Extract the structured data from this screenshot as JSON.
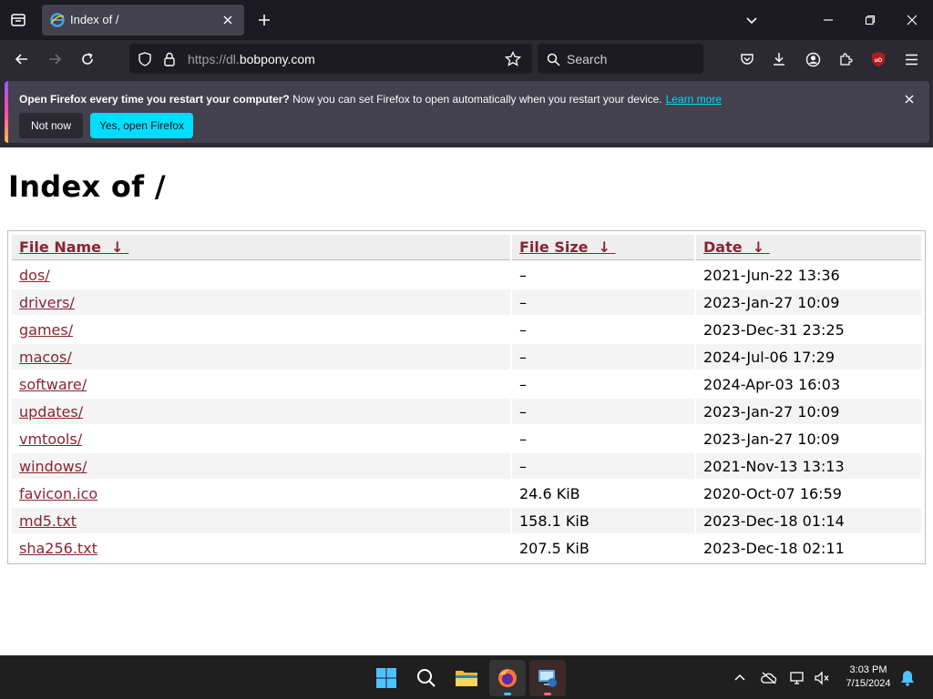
{
  "browser": {
    "tab_title": "Index of /",
    "url_scheme": "https://dl.",
    "url_host": "bobpony.com",
    "search_placeholder": "Search"
  },
  "notification": {
    "bold_text": "Open Firefox every time you restart your computer?",
    "text": " Now you can set Firefox to open automatically when you restart your device.",
    "link_text": "Learn more",
    "not_now_label": "Not now",
    "yes_label": "Yes, open Firefox"
  },
  "page": {
    "title": "Index of /",
    "columns": [
      {
        "label": "File Name",
        "sort_arrow": "↓"
      },
      {
        "label": "File Size",
        "sort_arrow": "↓"
      },
      {
        "label": "Date",
        "sort_arrow": "↓"
      }
    ],
    "rows": [
      {
        "name": "dos/",
        "size": "–",
        "date": "2021-Jun-22 13:36"
      },
      {
        "name": "drivers/",
        "size": "–",
        "date": "2023-Jan-27 10:09"
      },
      {
        "name": "games/",
        "size": "–",
        "date": "2023-Dec-31 23:25"
      },
      {
        "name": "macos/",
        "size": "–",
        "date": "2024-Jul-06 17:29"
      },
      {
        "name": "software/",
        "size": "–",
        "date": "2024-Apr-03 16:03"
      },
      {
        "name": "updates/",
        "size": "–",
        "date": "2023-Jan-27 10:09"
      },
      {
        "name": "vmtools/",
        "size": "–",
        "date": "2023-Jan-27 10:09"
      },
      {
        "name": "windows/",
        "size": "–",
        "date": "2021-Nov-13 13:13"
      },
      {
        "name": "favicon.ico",
        "size": "24.6 KiB",
        "date": "2020-Oct-07 16:59"
      },
      {
        "name": "md5.txt",
        "size": "158.1 KiB",
        "date": "2023-Dec-18 01:14"
      },
      {
        "name": "sha256.txt",
        "size": "207.5 KiB",
        "date": "2023-Dec-18 02:11"
      }
    ]
  },
  "taskbar": {
    "time": "3:03 PM",
    "date": "7/15/2024"
  },
  "colors": {
    "accent": "#00ddff",
    "link": "#8b2332",
    "ublock_red": "#b71c1c"
  }
}
